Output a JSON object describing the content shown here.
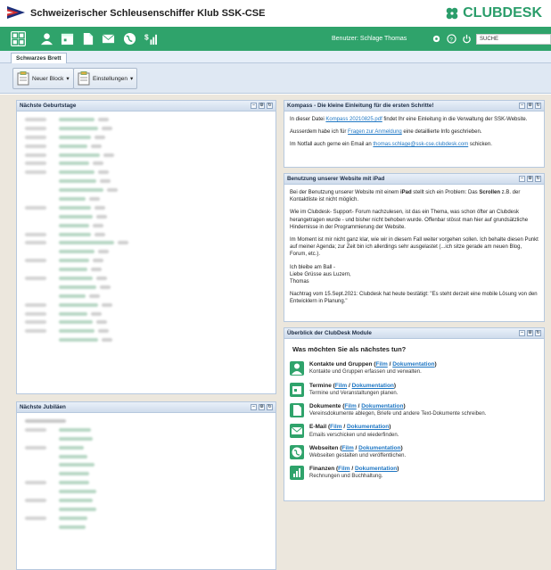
{
  "header": {
    "club_title": "Schweizerischer Schleusenschiffer Klub SSK-CSE",
    "brand": "CLUBDESK"
  },
  "navbar": {
    "user_label": "Benutzer: Schlage Thomas",
    "search_value": "SUCHE",
    "icons": [
      "dashboard-icon",
      "contacts-icon",
      "calendar-icon",
      "documents-icon",
      "email-icon",
      "web-icon",
      "finance-icon"
    ]
  },
  "tabs": {
    "active": "Schwarzes Brett"
  },
  "toolbar": {
    "new_block": "Neuer Block",
    "settings": "Einstellungen"
  },
  "panels": {
    "birthdays": {
      "title": "Nächste Geburtstage"
    },
    "jubilees": {
      "title": "Nächste Jubiläen"
    },
    "compass": {
      "title": "Kompass - Die kleine Einleitung für die ersten Schritte!",
      "p1_pre": "In dieser Datei ",
      "p1_link": "Kompass 20210825.pdf",
      "p1_post": " findet Ihr eine Einleitung in die Verwaltung der SSK-Website.",
      "p2_pre": "Ausserdem habe ich für ",
      "p2_link": "Fragen zur Anmeldung",
      "p2_post": " eine detaillierte Info geschrieben.",
      "p3_pre": "Im Notfall auch gerne ein Email an ",
      "p3_link": "thomas.schlage@ssk-cse.clubdesk.com",
      "p3_post": " schicken."
    },
    "ipad": {
      "title": "Benutzung unserer Website mit iPad",
      "p1_a": "Bei der Benutzung unserer Website mit einem ",
      "p1_b": "iPad",
      "p1_c": " stellt sich ein Problem: Das ",
      "p1_d": "Scrollen",
      "p1_e": " z.B. der Kontaktliste ist nicht möglich.",
      "p2": "Wie im Clubdesk- Support- Forum nachzulesen, ist das ein Thema, was schon öfter an Clubdesk herangetragen wurde - und bisher nicht behoben wurde. Offenbar stösst man hier auf grundsätzliche Hindernisse in der Programmierung der Website.",
      "p3": "Im Moment ist mir nicht ganz klar, wie wir in diesem Fall weiter vorgehen sollen. Ich behalte diesen Punkt auf meiner Agenda; zur Zeit bin ich allerdings sehr ausgelastet (...ich sitze gerade am neuen Blog, Forum, etc.).",
      "p4a": "Ich bleibe am Ball -",
      "p4b": "Liebe Grüsse aus Luzern,",
      "p4c": "Thomas",
      "p5": "Nachtrag vom 15.Sept.2021: Clubdesk hat heute bestätigt: \"Es steht derzeit eine mobile Lösung von den Entwicklern in Planung.\""
    },
    "modules": {
      "title": "Überblick der ClubDesk Module",
      "heading": "Was möchten Sie als nächstes tun?",
      "film": "Film",
      "doc": "Dokumentation",
      "items": [
        {
          "name": "Kontakte und Gruppen",
          "desc": "Kontakte und Gruppen erfassen und verwalten."
        },
        {
          "name": "Termine",
          "desc": "Termine und Veranstaltungen planen."
        },
        {
          "name": "Dokumente",
          "desc": "Vereinsdokumente ablegen, Briefe und andere Text-Dokumente schreiben."
        },
        {
          "name": "E-Mail",
          "desc": "Emails verschicken und wiederfinden."
        },
        {
          "name": "Webseiten",
          "desc": "Webseiten gestalten und veröffentlichen."
        },
        {
          "name": "Finanzen",
          "desc": "Rechnungen und Buchhaltung."
        }
      ]
    }
  },
  "colors": {
    "green": "#2fa36b",
    "brand": "#2a9d6a",
    "link": "#1f77c4",
    "panel_border": "#b6c8de"
  }
}
